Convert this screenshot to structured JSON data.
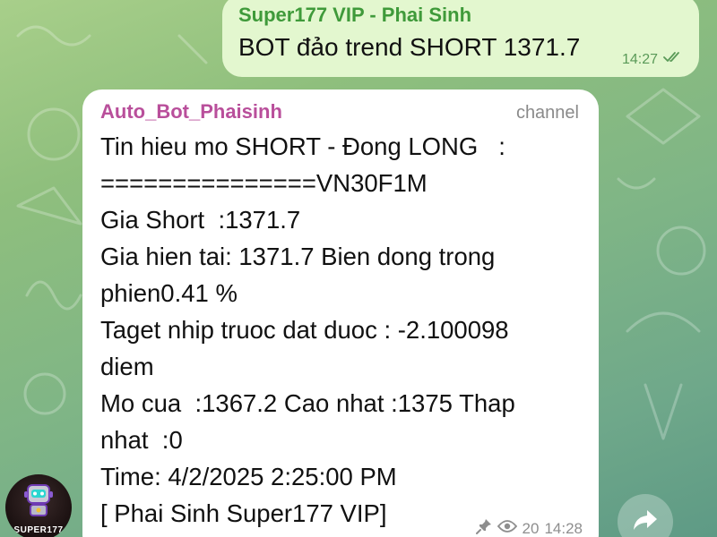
{
  "outgoing_message": {
    "sender": "Super177 VIP - Phai Sinh",
    "text": "BOT đảo trend SHORT 1371.7",
    "time": "14:27",
    "status_icon": "double-check-icon"
  },
  "incoming_message": {
    "sender": "Auto_Bot_Phaisinh",
    "badge": "channel",
    "lines": [
      "Tin hieu mo SHORT - Đong LONG   :",
      "===============VN30F1M",
      "Gia Short  :1371.7",
      "Gia hien tai: 1371.7 Bien dong trong",
      "phien0.41 %",
      "Taget nhip truoc dat duoc : -2.100098",
      "diem",
      "Mo cua  :1367.2 Cao nhat :1375 Thap",
      "nhat  :0",
      "Time: 4/2/2025 2:25:00 PM",
      "[ Phai Sinh Super177 VIP]"
    ],
    "views": "20",
    "time": "14:28",
    "icons": [
      "pin-icon",
      "eye-icon"
    ]
  },
  "avatar": {
    "label": "SUPER177",
    "icon": "robot-icon"
  },
  "forward_button": {
    "icon": "forward-arrow-icon"
  },
  "colors": {
    "outgoing_bubble": "#e3f7cf",
    "outgoing_sender": "#3f9a3a",
    "incoming_bubble": "#ffffff",
    "incoming_sender": "#b94f9b",
    "meta_gray": "#8e8e8e"
  }
}
